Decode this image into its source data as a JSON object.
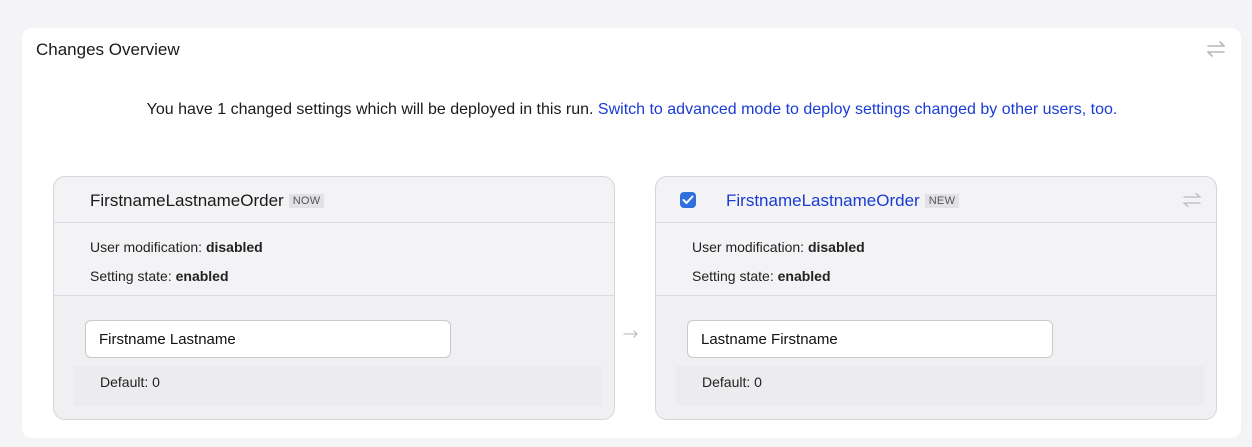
{
  "panel": {
    "title": "Changes Overview",
    "toggle_icon": "swap-arrows-icon"
  },
  "intro": {
    "text": "You have 1 changed settings which will be deployed in this run.",
    "link": "Switch to advanced mode to deploy settings changed by other users, too."
  },
  "cards": {
    "current": {
      "name": "FirstnameLastnameOrder",
      "tag": "NOW",
      "user_modification_label": "User modification:",
      "user_modification_value": "disabled",
      "setting_state_label": "Setting state:",
      "setting_state_value": "enabled",
      "field_value": "Firstname Lastname",
      "default_text": "Default: 0"
    },
    "new": {
      "checked": true,
      "name": "FirstnameLastnameOrder",
      "tag": "NEW",
      "user_modification_label": "User modification:",
      "user_modification_value": "disabled",
      "setting_state_label": "Setting state:",
      "setting_state_value": "enabled",
      "field_value": "Lastname Firstname",
      "default_text": "Default: 0",
      "toggle_icon": "swap-arrows-icon"
    }
  },
  "between_icon": "arrow-right-icon",
  "colors": {
    "link": "#1a3bd6",
    "checkbox": "#2f6fe0",
    "panel_bg": "#ffffff",
    "card_bg": "#f3f3f5"
  }
}
